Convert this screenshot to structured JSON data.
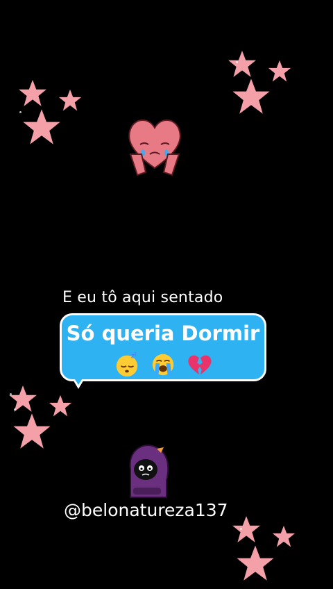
{
  "caption": "E eu tô aqui sentado",
  "bubble": {
    "text": "Só queria Dormir",
    "emojis": [
      "sleeping-face-icon",
      "loudly-crying-face-icon",
      "broken-heart-icon"
    ]
  },
  "handle": "@belonatureza137",
  "stickers": [
    "sad-heart-icon",
    "hooded-sad-figure-icon"
  ],
  "colors": {
    "background": "#000000",
    "bubble": "#2eb2f2",
    "bubble_border": "#ffffff",
    "star": "#f4a0a8",
    "text": "#ffffff"
  }
}
